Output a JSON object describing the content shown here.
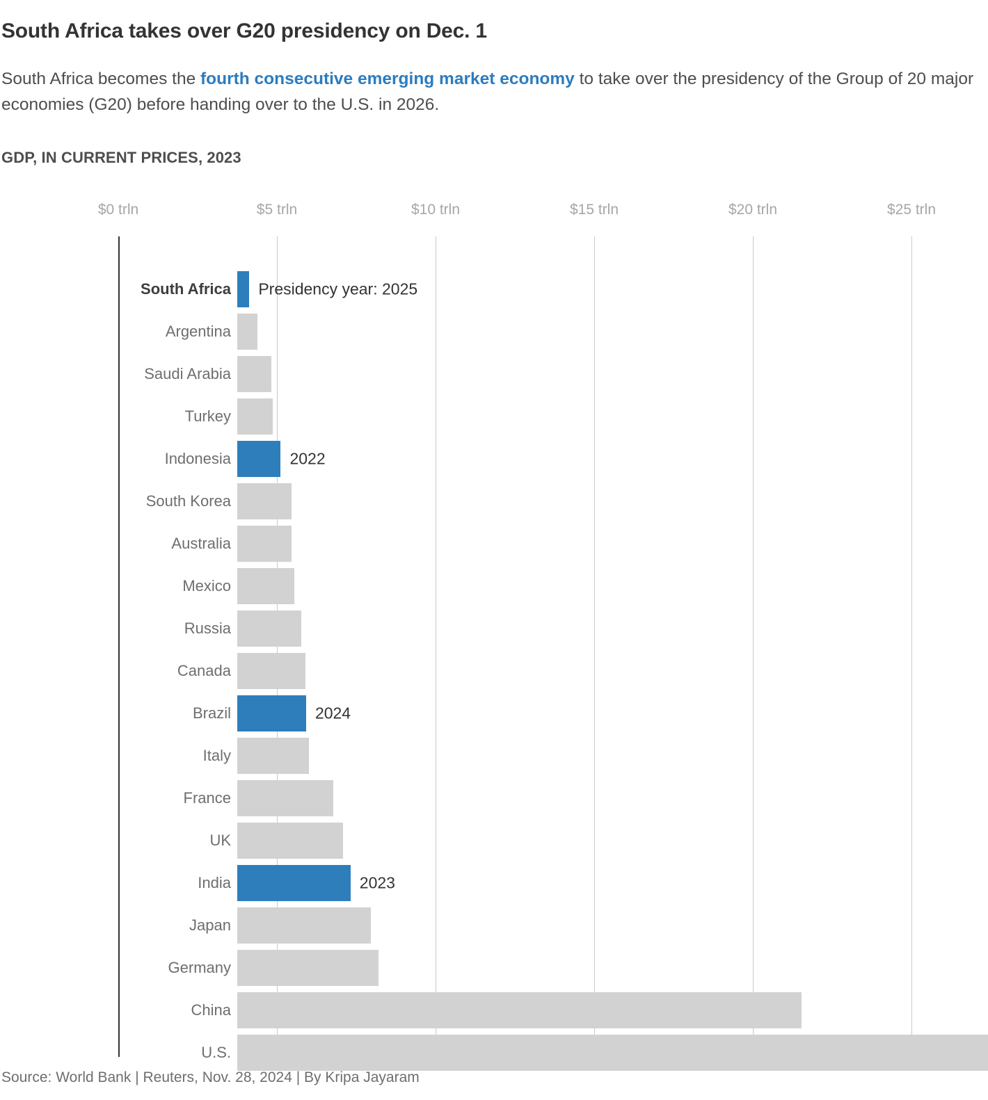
{
  "header": {
    "headline": "South Africa takes over G20 presidency on Dec. 1",
    "subtitle_part1": "South Africa becomes the ",
    "subtitle_highlight": "fourth consecutive emerging market economy",
    "subtitle_part2": " to take over the presidency of the Group of 20 major economies (G20) before handing over to the U.S. in 2026."
  },
  "colors": {
    "accent_blue": "#2e7ebc",
    "bar_gray": "#d2d2d2",
    "axis_black": "#333333",
    "gridline_gray": "#c9c9c9",
    "label_gray": "#6e6e6e"
  },
  "footer": {
    "source": "Source: World Bank | Reuters, Nov. 28, 2024 | By Kripa Jayaram"
  },
  "chart_data": {
    "type": "bar",
    "orientation": "horizontal",
    "title": "GDP, IN CURRENT PRICES, 2023",
    "xlabel": "",
    "ylabel": "",
    "xlim": [
      0,
      27.4
    ],
    "grid": true,
    "legend": "none",
    "tick_labels": [
      "$0 trln",
      "$5 trln",
      "$10 trln",
      "$15 trln",
      "$20 trln",
      "$25 trln"
    ],
    "tick_values": [
      0,
      5,
      10,
      15,
      20,
      25
    ],
    "categories": [
      "South Africa",
      "Argentina",
      "Saudi Arabia",
      "Turkey",
      "Indonesia",
      "South Korea",
      "Australia",
      "Mexico",
      "Russia",
      "Canada",
      "Brazil",
      "Italy",
      "France",
      "UK",
      "India",
      "Japan",
      "Germany",
      "China",
      "U.S."
    ],
    "values": [
      0.38,
      0.64,
      1.07,
      1.11,
      1.37,
      1.71,
      1.72,
      1.79,
      2.02,
      2.14,
      2.17,
      2.25,
      3.03,
      3.34,
      3.57,
      4.21,
      4.46,
      17.79,
      27.36
    ],
    "bars": [
      {
        "label": "South Africa",
        "value": 0.38,
        "highlight": true,
        "note": "Presidency year: 2025"
      },
      {
        "label": "Argentina",
        "value": 0.64,
        "highlight": false,
        "note": ""
      },
      {
        "label": "Saudi Arabia",
        "value": 1.07,
        "highlight": false,
        "note": ""
      },
      {
        "label": "Turkey",
        "value": 1.11,
        "highlight": false,
        "note": ""
      },
      {
        "label": "Indonesia",
        "value": 1.37,
        "highlight": true,
        "note": "2022"
      },
      {
        "label": "South Korea",
        "value": 1.71,
        "highlight": false,
        "note": ""
      },
      {
        "label": "Australia",
        "value": 1.72,
        "highlight": false,
        "note": ""
      },
      {
        "label": "Mexico",
        "value": 1.79,
        "highlight": false,
        "note": ""
      },
      {
        "label": "Russia",
        "value": 2.02,
        "highlight": false,
        "note": ""
      },
      {
        "label": "Canada",
        "value": 2.14,
        "highlight": false,
        "note": ""
      },
      {
        "label": "Brazil",
        "value": 2.17,
        "highlight": true,
        "note": "2024"
      },
      {
        "label": "Italy",
        "value": 2.25,
        "highlight": false,
        "note": ""
      },
      {
        "label": "France",
        "value": 3.03,
        "highlight": false,
        "note": ""
      },
      {
        "label": "UK",
        "value": 3.34,
        "highlight": false,
        "note": ""
      },
      {
        "label": "India",
        "value": 3.57,
        "highlight": true,
        "note": "2023"
      },
      {
        "label": "Japan",
        "value": 4.21,
        "highlight": false,
        "note": ""
      },
      {
        "label": "Germany",
        "value": 4.46,
        "highlight": false,
        "note": ""
      },
      {
        "label": "China",
        "value": 17.79,
        "highlight": false,
        "note": ""
      },
      {
        "label": "U.S.",
        "value": 27.36,
        "highlight": false,
        "note": ""
      }
    ]
  }
}
